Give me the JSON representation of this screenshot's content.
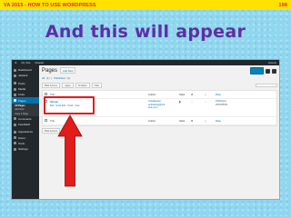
{
  "topbar": {
    "left": "VA 2015 -  HOW TO USE WORDPRESS",
    "right": "198"
  },
  "headline": "And this will appear",
  "colors": {
    "topbar": "#ffe200",
    "topbar_text": "#e8231c",
    "headline": "#5e2ea5",
    "annotation": "#e21b1b",
    "wp_blue": "#0073aa"
  },
  "wp": {
    "adminbar": {
      "site": "My Site",
      "mode": "Reader",
      "howdy": "Howdy"
    },
    "sidebar": {
      "items": [
        {
          "label": "Dashboard",
          "icon": "dashboard-icon"
        },
        {
          "label": "Jetpack",
          "icon": "jetpack-icon"
        },
        {
          "label": "Posts",
          "icon": "pin-icon"
        },
        {
          "label": "Media",
          "icon": "media-icon"
        },
        {
          "label": "Links",
          "icon": "link-icon"
        },
        {
          "label": "Pages",
          "icon": "page-icon"
        }
      ],
      "subitems": [
        "All Pages",
        "Add New",
        "Copy a Page"
      ],
      "items2": [
        {
          "label": "Comments",
          "icon": "comment-icon"
        },
        {
          "label": "Feedback",
          "icon": "feedback-icon"
        },
        {
          "label": "Appearance",
          "icon": "brush-icon"
        },
        {
          "label": "Users",
          "icon": "user-icon"
        },
        {
          "label": "Tools",
          "icon": "wrench-icon"
        },
        {
          "label": "Settings",
          "icon": "settings-icon"
        }
      ]
    },
    "page": {
      "title": "Pages",
      "add_new": "Add New",
      "status": {
        "all": "All",
        "count": "(1)",
        "published": "Published",
        "published_count": "(1)"
      },
      "bulk": "Bulk Actions",
      "apply": "Apply",
      "all_dates": "All dates",
      "filter": "Filter",
      "columns": {
        "title": "Title",
        "author": "Author",
        "state": "Stats",
        "date": "Date"
      },
      "row": {
        "title": "About",
        "actions": "Edit · Quick Edit · Trash · View",
        "author_lines": [
          "virtualassist",
          "anttraining@out",
          "look.com"
        ],
        "date_lines": [
          "Published",
          "2015/05/09"
        ]
      }
    }
  }
}
